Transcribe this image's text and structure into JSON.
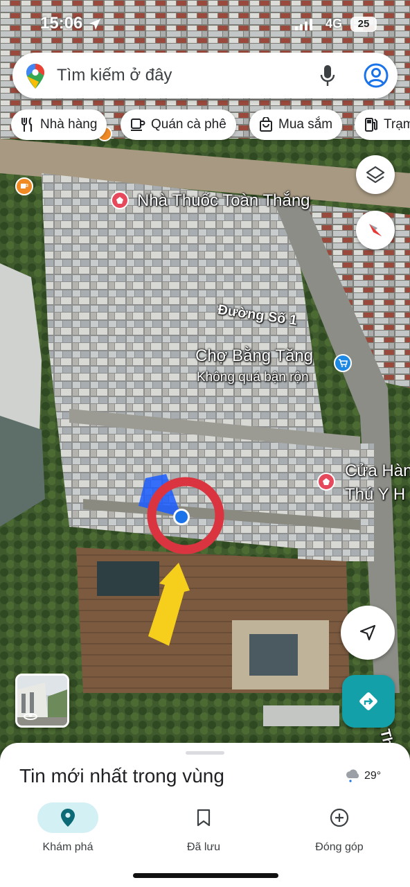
{
  "status_bar": {
    "time": "15:06",
    "network": "4G",
    "battery": "25"
  },
  "search": {
    "placeholder": "Tìm kiếm ở đây"
  },
  "chips": [
    {
      "label": "Nhà hàng",
      "icon": "fork-knife-icon"
    },
    {
      "label": "Quán cà phê",
      "icon": "coffee-cup-icon"
    },
    {
      "label": "Mua sắm",
      "icon": "shopping-bag-icon"
    },
    {
      "label": "Trạm",
      "icon": "gas-pump-icon"
    }
  ],
  "map": {
    "labels": {
      "pharmacy": "Nhà Thuốc Toàn Thắng",
      "street": "Đường Số 1",
      "market": "Chợ Bằng Tăng",
      "market_status": "Không quá bận rộn",
      "shop_line1": "Cửa Hàn",
      "shop_line2": "Thú Y H",
      "road_vertical": "Đ. Thái Th"
    },
    "annotation_colors": {
      "circle": "#d9343f",
      "arrow": "#f5cf1c"
    }
  },
  "controls": {
    "layers": "layers-icon",
    "compass": "compass-icon",
    "my_location": "navigation-arrow-icon",
    "directions": "directions-icon"
  },
  "sheet": {
    "title": "Tin mới nhất trong vùng",
    "temperature": "29°"
  },
  "bottom_nav": [
    {
      "label": "Khám phá",
      "icon": "location-pin-icon",
      "active": true
    },
    {
      "label": "Đã lưu",
      "icon": "bookmark-icon",
      "active": false
    },
    {
      "label": "Đóng góp",
      "icon": "add-circle-icon",
      "active": false
    }
  ],
  "colors": {
    "accent": "#1a73e8",
    "active_nav_bg": "#d3f0f5",
    "directions": "#14a0a8"
  }
}
